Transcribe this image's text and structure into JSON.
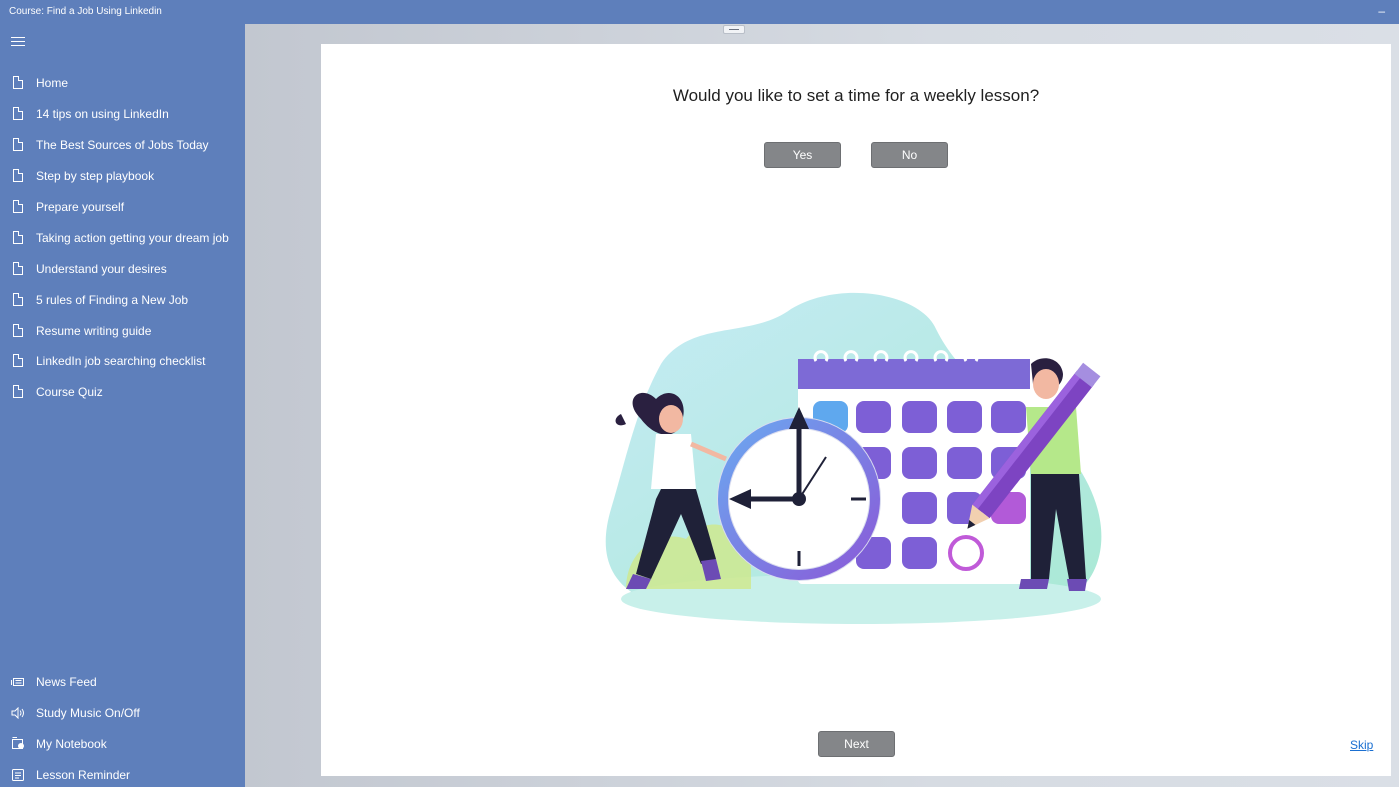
{
  "window": {
    "title": "Course: Find a Job Using Linkedin",
    "minimize_glyph": "–"
  },
  "sidebar": {
    "menu_icon": "hamburger-icon",
    "items": [
      {
        "label": "Home",
        "icon": "document-icon"
      },
      {
        "label": "14 tips on using LinkedIn",
        "icon": "document-icon"
      },
      {
        "label": "The Best Sources of Jobs Today",
        "icon": "document-icon"
      },
      {
        "label": "Step by step playbook",
        "icon": "document-icon"
      },
      {
        "label": "Prepare yourself",
        "icon": "document-icon"
      },
      {
        "label": "Taking action getting your dream job",
        "icon": "document-icon"
      },
      {
        "label": "Understand your desires",
        "icon": "document-icon"
      },
      {
        "label": "5 rules of Finding a New Job",
        "icon": "document-icon"
      },
      {
        "label": "Resume writing guide",
        "icon": "document-icon"
      },
      {
        "label": "LinkedIn job searching checklist",
        "icon": "document-icon"
      },
      {
        "label": "Course Quiz",
        "icon": "document-icon"
      }
    ],
    "bottom_items": [
      {
        "label": "News Feed",
        "icon": "news-icon"
      },
      {
        "label": "Study Music On/Off",
        "icon": "speaker-icon"
      },
      {
        "label": "My Notebook",
        "icon": "notebook-icon"
      },
      {
        "label": "Lesson Reminder",
        "icon": "reminder-icon"
      }
    ]
  },
  "dialog": {
    "question": "Would you like to set a time for a weekly lesson?",
    "yes_label": "Yes",
    "no_label": "No",
    "next_label": "Next",
    "skip_label": "Skip"
  },
  "colors": {
    "sidebar_bg": "#5e7fbb",
    "button_bg": "#848689",
    "link": "#1a6fd1",
    "calendar_purple": "#7d5fd6",
    "illustration_teal": "#a8ead8"
  }
}
